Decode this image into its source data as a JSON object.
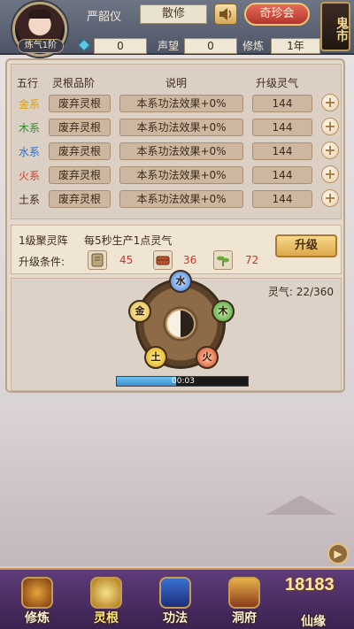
{
  "header": {
    "player_name": "严韶仪",
    "sect": "散修",
    "realm": "炼气1阶",
    "treasure_label": "奇珍会",
    "ghost_market_label": "鬼市",
    "gems": "0",
    "reputation_label": "声望",
    "reputation": "0",
    "cultivate_label": "修炼",
    "cultivate_time": "1年"
  },
  "table": {
    "headers": [
      "五行",
      "灵根品阶",
      "说明",
      "升级灵气"
    ],
    "rows": [
      {
        "element": "金系",
        "color": "#d4a017",
        "grade": "废弃灵根",
        "desc": "本系功法效果+0%",
        "cost": "144"
      },
      {
        "element": "木系",
        "color": "#2e8b2e",
        "grade": "废弃灵根",
        "desc": "本系功法效果+0%",
        "cost": "144"
      },
      {
        "element": "水系",
        "color": "#2a6fd6",
        "grade": "废弃灵根",
        "desc": "本系功法效果+0%",
        "cost": "144"
      },
      {
        "element": "火系",
        "color": "#d63a2a",
        "grade": "废弃灵根",
        "desc": "本系功法效果+0%",
        "cost": "144"
      },
      {
        "element": "土系",
        "color": "#3a2a1a",
        "grade": "废弃灵根",
        "desc": "本系功法效果+0%",
        "cost": "144"
      }
    ]
  },
  "spirit_array": {
    "title": "1级聚灵阵",
    "desc": "每5秒生产1点灵气",
    "condition_label": "升级条件:",
    "resources": [
      {
        "icon": "scroll-icon",
        "value": "45"
      },
      {
        "icon": "wood-icon",
        "value": "36"
      },
      {
        "icon": "herb-icon",
        "value": "72"
      }
    ],
    "upgrade_label": "升级",
    "qi_label": "灵气:",
    "qi_value": "22/360",
    "timer": "00:03",
    "progress": 0.45,
    "wheel_elements": [
      "水",
      "木",
      "火",
      "土",
      "金"
    ]
  },
  "nav": {
    "items": [
      "修炼",
      "灵根",
      "功法",
      "洞府",
      "仙缘"
    ],
    "brand": "18183"
  }
}
